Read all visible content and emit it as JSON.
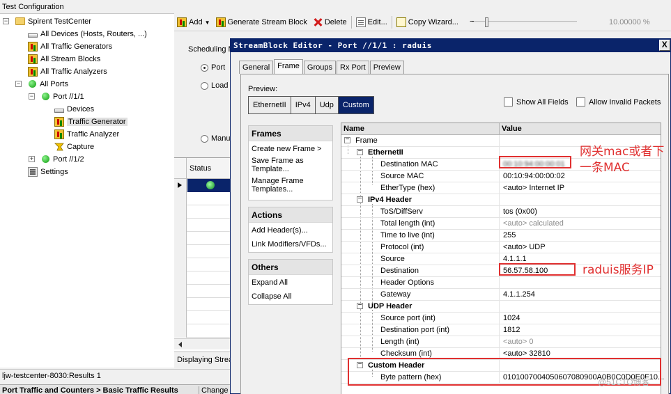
{
  "window": {
    "title": "Test Configuration"
  },
  "tree": {
    "root": "Spirent TestCenter",
    "items": [
      "All Devices (Hosts, Routers, ...)",
      "All Traffic Generators",
      "All Stream Blocks",
      "All Traffic Analyzers",
      "All Ports",
      "Port //1/1",
      "Devices",
      "Traffic Generator",
      "Traffic Analyzer",
      "Capture",
      "Port //1/2",
      "Settings"
    ]
  },
  "toolbar": {
    "add": "Add",
    "generate": "Generate Stream Block",
    "delete": "Delete",
    "edit": "Edit...",
    "copy_wizard": "Copy Wizard...",
    "zoom": "10.00000 %"
  },
  "background_panel": {
    "scheduling": "Scheduling M",
    "radio_port": "Port",
    "radio_load": "Load",
    "radio_manual": "Manu",
    "status_col": "Status",
    "displaying": "Displaying Strea"
  },
  "status_bar": {
    "results": "ljw-testcenter-8030:Results 1",
    "bottom_tab": "Port Traffic and Counters > Basic Traffic Results",
    "change": "Change"
  },
  "dialog": {
    "title": "StreamBlock Editor - Port //1/1 : raduis",
    "close": "X",
    "tabs": [
      "General",
      "Frame",
      "Groups",
      "Rx Port",
      "Preview"
    ],
    "preview_label": "Preview:",
    "segments": [
      "EthernetII",
      "IPv4",
      "Udp",
      "Custom"
    ],
    "show_all_fields": "Show All Fields",
    "allow_invalid": "Allow Invalid Packets",
    "frames": {
      "title": "Frames",
      "items": [
        "Create new Frame >",
        "Save Frame as Template...",
        "Manage Frame Templates..."
      ]
    },
    "actions": {
      "title": "Actions",
      "items": [
        "Add Header(s)...",
        "Link Modifiers/VFDs..."
      ]
    },
    "others": {
      "title": "Others",
      "items": [
        "Expand All",
        "Collapse All"
      ]
    },
    "grid": {
      "col_name": "Name",
      "col_value": "Value",
      "rows": [
        {
          "name": "Frame",
          "value": ""
        },
        {
          "name": "EthernetII",
          "value": ""
        },
        {
          "name": "Destination MAC",
          "value": "00:10:94:00:00:01"
        },
        {
          "name": "Source MAC",
          "value": "00:10:94:00:00:02"
        },
        {
          "name": "EtherType (hex)",
          "value": "<auto> Internet IP"
        },
        {
          "name": "IPv4 Header",
          "value": ""
        },
        {
          "name": "ToS/DiffServ",
          "value": "tos (0x00)"
        },
        {
          "name": "Total length (int)",
          "value": "<auto> calculated"
        },
        {
          "name": "Time to live (int)",
          "value": "255"
        },
        {
          "name": "Protocol (int)",
          "value": "<auto> UDP"
        },
        {
          "name": "Source",
          "value": "4.1.1.1"
        },
        {
          "name": "Destination",
          "value": "56.57.58.100"
        },
        {
          "name": "Header Options",
          "value": ""
        },
        {
          "name": "Gateway",
          "value": "4.1.1.254"
        },
        {
          "name": "UDP Header",
          "value": ""
        },
        {
          "name": "Source port (int)",
          "value": "1024"
        },
        {
          "name": "Destination port (int)",
          "value": "1812"
        },
        {
          "name": "Length (int)",
          "value": "<auto> 0"
        },
        {
          "name": "Checksum (int)",
          "value": "<auto> 32810"
        },
        {
          "name": "Custom Header",
          "value": ""
        },
        {
          "name": "Byte pattern (hex)",
          "value": "0101007004050607080900A0B0C0D0E0F10..."
        }
      ]
    }
  },
  "annotations": {
    "mac_note": "网关mac或者下一条MAC",
    "ip_note": "raduis服务IP",
    "red": "#e03030"
  },
  "watermark": "@51CTO博客",
  "colors": {
    "title_bar": "#0a246a",
    "selected_segment": "#0a246a"
  }
}
